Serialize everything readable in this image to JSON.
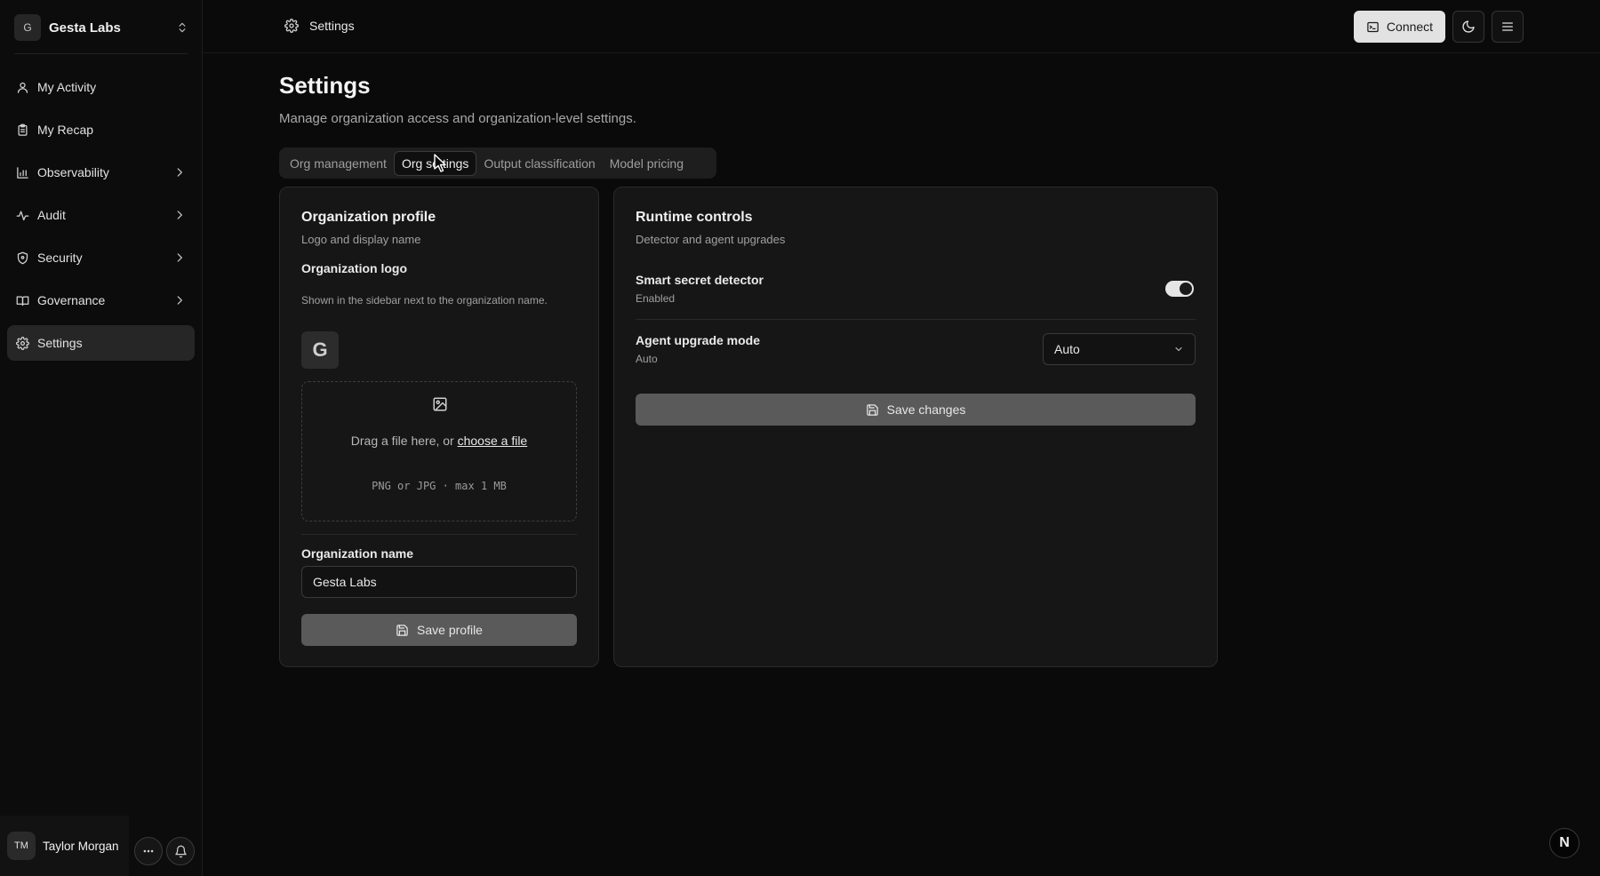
{
  "org_switcher": {
    "avatar_initial": "G",
    "name": "Gesta Labs"
  },
  "sidebar": {
    "items": [
      {
        "label": "My Activity",
        "icon": "user-icon",
        "has_submenu": false,
        "active": false
      },
      {
        "label": "My Recap",
        "icon": "clipboard-icon",
        "has_submenu": false,
        "active": false
      },
      {
        "label": "Observability",
        "icon": "bar-chart-icon",
        "has_submenu": true,
        "active": false
      },
      {
        "label": "Audit",
        "icon": "activity-icon",
        "has_submenu": true,
        "active": false
      },
      {
        "label": "Security",
        "icon": "shield-icon",
        "has_submenu": true,
        "active": false
      },
      {
        "label": "Governance",
        "icon": "book-icon",
        "has_submenu": true,
        "active": false
      },
      {
        "label": "Settings",
        "icon": "gear-icon",
        "has_submenu": false,
        "active": true
      }
    ]
  },
  "user": {
    "initials": "TM",
    "name": "Taylor Morgan"
  },
  "header": {
    "breadcrumb": "Settings",
    "connect_label": "Connect"
  },
  "page": {
    "title": "Settings",
    "subtitle": "Manage organization access and organization-level settings."
  },
  "tabs": [
    {
      "label": "Org management",
      "active": false
    },
    {
      "label": "Org settings",
      "active": true
    },
    {
      "label": "Output classification",
      "active": false
    },
    {
      "label": "Model pricing",
      "active": false
    }
  ],
  "profile_card": {
    "title": "Organization profile",
    "subtitle": "Logo and display name",
    "logo_label": "Organization logo",
    "logo_help": "Shown in the sidebar next to the organization name.",
    "logo_initial": "G",
    "dropzone_text": "Drag a file here, or ",
    "dropzone_link": "choose a file",
    "dropzone_hint": "PNG or JPG · max 1 MB",
    "name_label": "Organization name",
    "name_value": "Gesta Labs",
    "save_label": "Save profile"
  },
  "runtime_card": {
    "title": "Runtime controls",
    "subtitle": "Detector and agent upgrades",
    "secret_detector_label": "Smart secret detector",
    "secret_detector_status": "Enabled",
    "secret_detector_on": true,
    "upgrade_mode_label": "Agent upgrade mode",
    "upgrade_mode_status": "Auto",
    "upgrade_mode_selected": "Auto",
    "save_label": "Save changes"
  },
  "corner_badge": "N"
}
